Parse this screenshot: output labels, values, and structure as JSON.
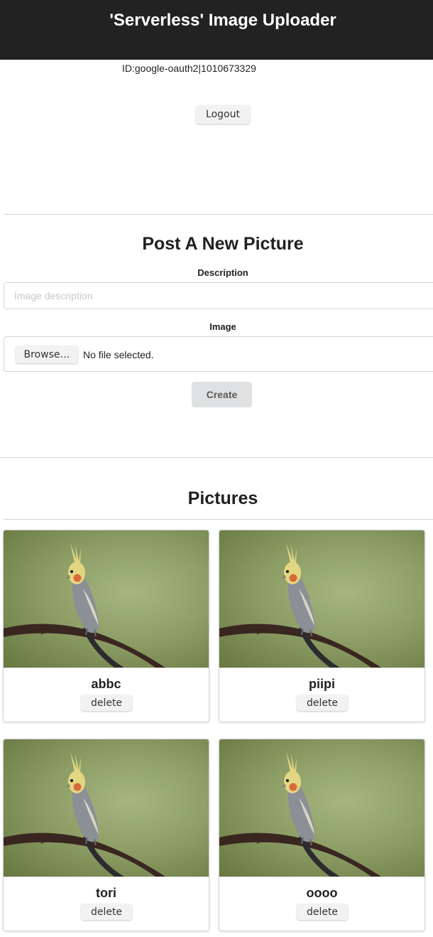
{
  "header": {
    "title": "'Serverless' Image Uploader"
  },
  "user": {
    "id_text": "ID:google-oauth2|1010673329",
    "logout_label": "Logout"
  },
  "post_form": {
    "title": "Post A New Picture",
    "description_label": "Description",
    "description_placeholder": "Image description",
    "description_value": "",
    "image_label": "Image",
    "browse_label": "Browse…",
    "file_status": "No file selected.",
    "create_label": "Create"
  },
  "pictures": {
    "title": "Pictures",
    "delete_label": "delete",
    "items": [
      {
        "name": "abbc"
      },
      {
        "name": "piipi"
      },
      {
        "name": "tori"
      },
      {
        "name": "oooo"
      }
    ]
  },
  "colors": {
    "topbar": "#222222",
    "button_bg": "#f2f2f2",
    "create_bg": "#e0e1e2",
    "divider": "#d4d4d5"
  }
}
